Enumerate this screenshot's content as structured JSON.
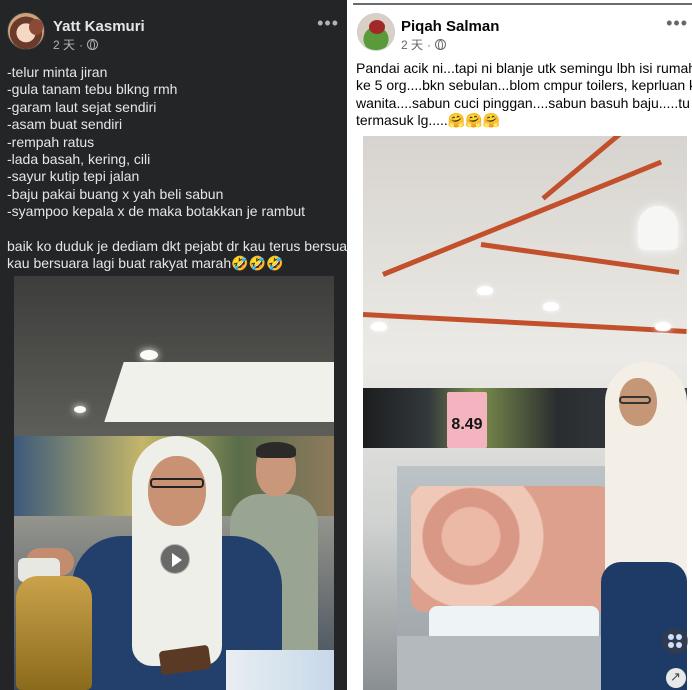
{
  "left_post": {
    "author": "Yatt Kasmuri",
    "time": "2 天",
    "separator": "·",
    "more": "•••",
    "lines": [
      "-telur minta jiran",
      "-gula tanam tebu blkng rmh",
      "-garam laut sejat sendiri",
      "-asam buat sendiri",
      "-rempah ratus",
      "-lada basah, kering, cili",
      "-sayur kutip tepi jalan",
      "-baju pakai buang x yah beli sabun",
      "-syampoo kepala x de maka botakkan je rambut"
    ],
    "comment_lines": [
      "baik ko duduk je dediam dkt pejabt dr kau terus bersuara,",
      "kau bersuara lagi buat rakyat marah🤣🤣🤣"
    ]
  },
  "right_post": {
    "author": "Piqah Salman",
    "time": "2 天",
    "separator": "·",
    "more": "•••",
    "lines": [
      "Pandai acik ni...tapi ni blanje utk semingu lbh isi rumah 4",
      "ke 5 org....bkn sebulan...blom cmpur toilers, keprluan kite",
      "wanita....sabun cuci pinggan....sabun basuh baju.....tu x",
      "termasuk lg.....🤗🤗🤗"
    ],
    "price_sign": "8.49"
  },
  "icons": {
    "play": "play-icon",
    "globe": "globe-icon",
    "more": "more-options-icon",
    "corner": "collage-icon",
    "expand": "expand-icon"
  }
}
